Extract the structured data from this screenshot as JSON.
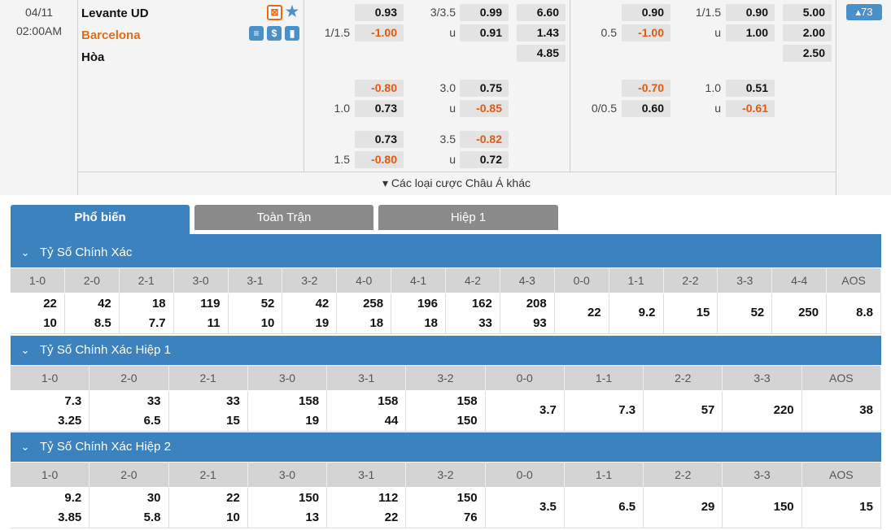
{
  "match": {
    "date": "04/11",
    "time": "02:00AM",
    "home": "Levante UD",
    "away": "Barcelona",
    "draw": "Hòa",
    "more_count": "▴73",
    "asian_more": "▾ Các loại cược Châu Á khác",
    "full_time": {
      "hdp_rows": [
        {
          "line": "",
          "home": "0.93",
          "ou_line": "3/3.5",
          "over": "0.99",
          "x12": "6.60"
        },
        {
          "line": "1/1.5",
          "home": "-1.00",
          "ou_line": "u",
          "over": "0.91",
          "x12": "1.43"
        },
        {
          "line": "",
          "home": "",
          "ou_line": "",
          "over": "",
          "x12": "4.85"
        }
      ],
      "alt1": [
        {
          "line": "",
          "home": "-0.80",
          "ou_line": "3.0",
          "over": "0.75"
        },
        {
          "line": "1.0",
          "home": "0.73",
          "ou_line": "u",
          "over": "-0.85"
        }
      ],
      "alt2": [
        {
          "line": "",
          "home": "0.73",
          "ou_line": "3.5",
          "over": "-0.82"
        },
        {
          "line": "1.5",
          "home": "-0.80",
          "ou_line": "u",
          "over": "0.72"
        }
      ]
    },
    "half_time": {
      "hdp_rows": [
        {
          "line": "",
          "home": "0.90",
          "ou_line": "1/1.5",
          "over": "0.90",
          "x12": "5.00"
        },
        {
          "line": "0.5",
          "home": "-1.00",
          "ou_line": "u",
          "over": "1.00",
          "x12": "2.00"
        },
        {
          "line": "",
          "home": "",
          "ou_line": "",
          "over": "",
          "x12": "2.50"
        }
      ],
      "alt1": [
        {
          "line": "",
          "home": "-0.70",
          "ou_line": "1.0",
          "over": "0.51"
        },
        {
          "line": "0/0.5",
          "home": "0.60",
          "ou_line": "u",
          "over": "-0.61"
        }
      ]
    }
  },
  "tabs": [
    "Phổ biến",
    "Toàn Trận",
    "Hiệp 1"
  ],
  "sections": [
    {
      "title": "Tỷ Số Chính Xác",
      "headers": [
        "1-0",
        "2-0",
        "2-1",
        "3-0",
        "3-1",
        "3-2",
        "4-0",
        "4-1",
        "4-2",
        "4-3",
        "0-0",
        "1-1",
        "2-2",
        "3-3",
        "4-4",
        "AOS"
      ],
      "values": [
        [
          "22",
          "10"
        ],
        [
          "42",
          "8.5"
        ],
        [
          "18",
          "7.7"
        ],
        [
          "119",
          "11"
        ],
        [
          "52",
          "10"
        ],
        [
          "42",
          "19"
        ],
        [
          "258",
          "18"
        ],
        [
          "196",
          "18"
        ],
        [
          "162",
          "33"
        ],
        [
          "208",
          "93"
        ],
        [
          "22"
        ],
        [
          "9.2"
        ],
        [
          "15"
        ],
        [
          "52"
        ],
        [
          "250"
        ],
        [
          "8.8"
        ]
      ]
    },
    {
      "title": "Tỷ Số Chính Xác Hiệp 1",
      "headers": [
        "1-0",
        "2-0",
        "2-1",
        "3-0",
        "3-1",
        "3-2",
        "0-0",
        "1-1",
        "2-2",
        "3-3",
        "AOS"
      ],
      "values": [
        [
          "7.3",
          "3.25"
        ],
        [
          "33",
          "6.5"
        ],
        [
          "33",
          "15"
        ],
        [
          "158",
          "19"
        ],
        [
          "158",
          "44"
        ],
        [
          "158",
          "150"
        ],
        [
          "3.7"
        ],
        [
          "7.3"
        ],
        [
          "57"
        ],
        [
          "220"
        ],
        [
          "38"
        ]
      ]
    },
    {
      "title": "Tỷ Số Chính Xác Hiệp 2",
      "headers": [
        "1-0",
        "2-0",
        "2-1",
        "3-0",
        "3-1",
        "3-2",
        "0-0",
        "1-1",
        "2-2",
        "3-3",
        "AOS"
      ],
      "values": [
        [
          "9.2",
          "3.85"
        ],
        [
          "30",
          "5.8"
        ],
        [
          "22",
          "10"
        ],
        [
          "150",
          "13"
        ],
        [
          "112",
          "22"
        ],
        [
          "150",
          "76"
        ],
        [
          "3.5"
        ],
        [
          "6.5"
        ],
        [
          "29"
        ],
        [
          "150"
        ],
        [
          "15"
        ]
      ]
    }
  ],
  "colors": {
    "accent": "#3b82be",
    "favorite": "#e06c1a",
    "negative": "#e05a10",
    "tab_inactive": "#8a8a8a"
  },
  "icons": [
    "live-stream-icon",
    "favorite-star-icon",
    "stats-icon",
    "dollar-icon",
    "chart-icon",
    "chevron-down-icon"
  ]
}
